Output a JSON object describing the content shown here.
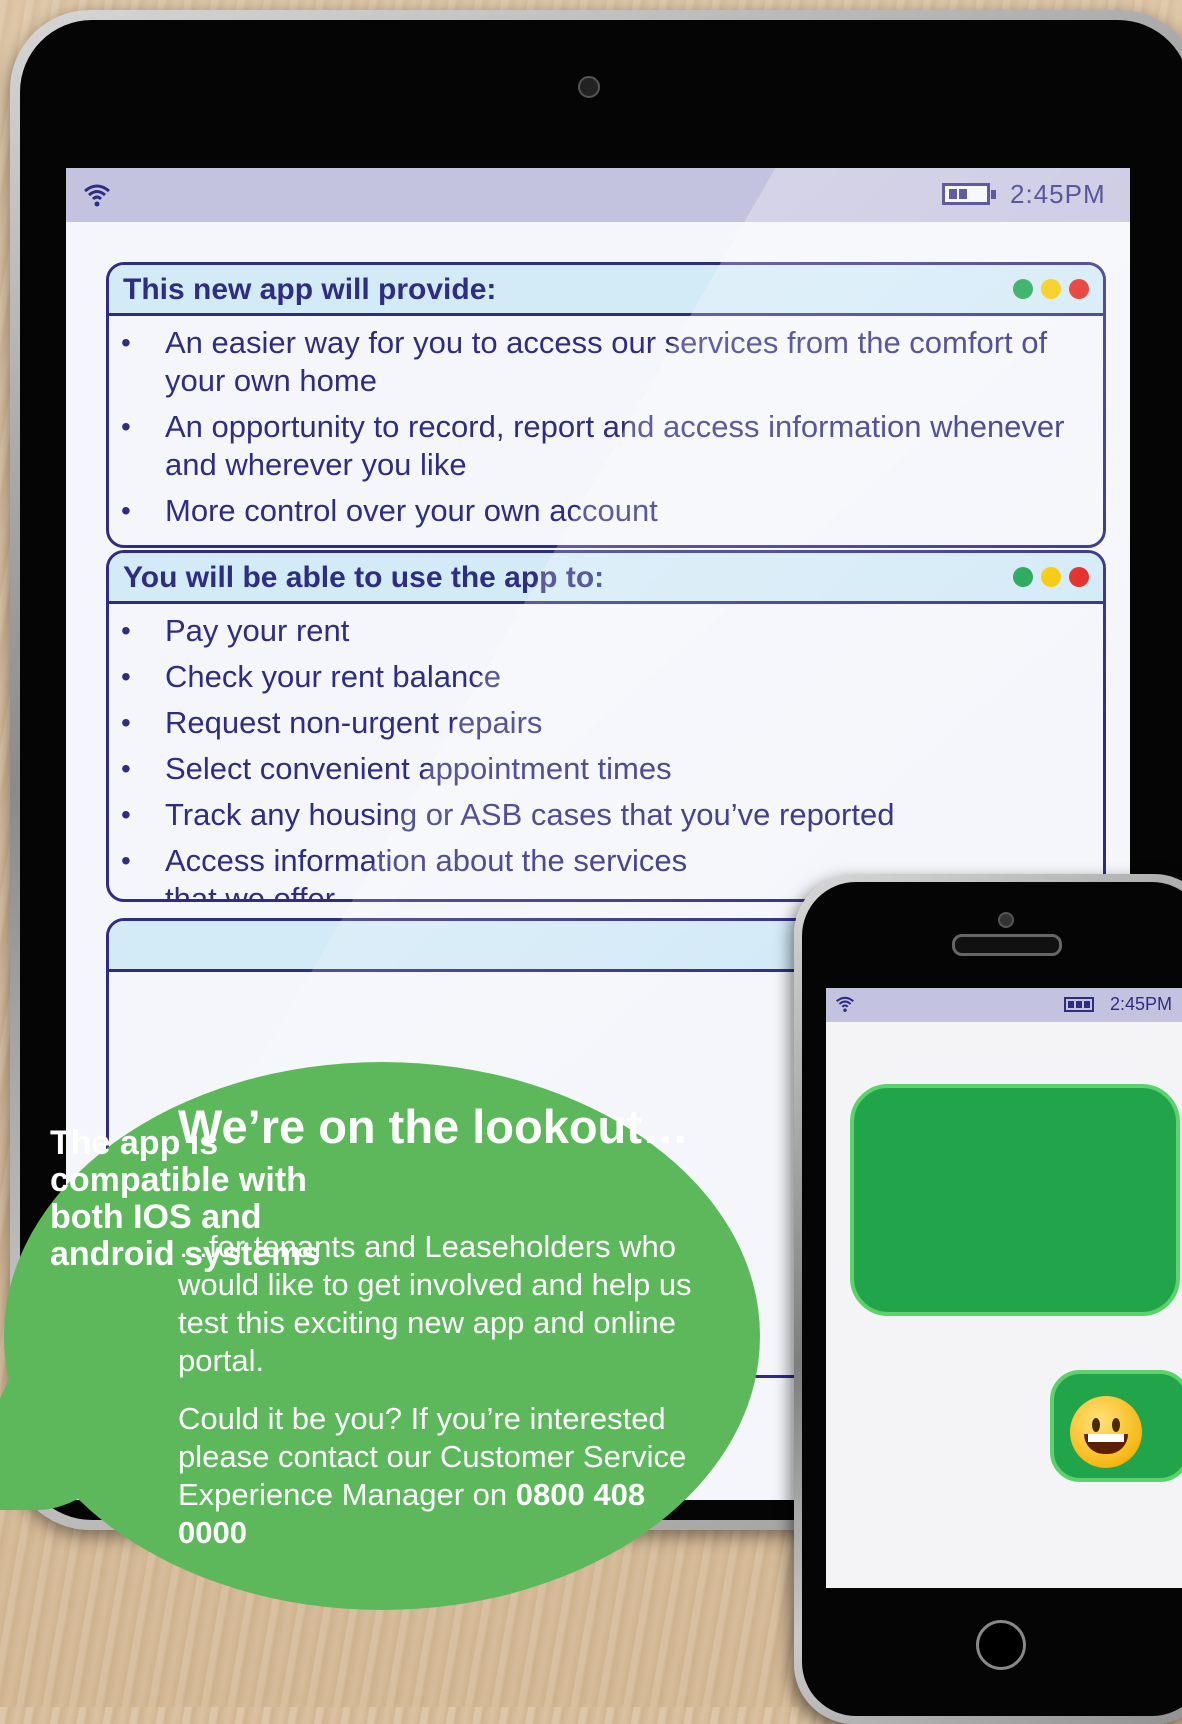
{
  "tablet": {
    "status_time": "2:45PM",
    "card1": {
      "title": "This new app will provide:",
      "items": [
        "An easier way for you to access our services from the comfort of your own home",
        "An opportunity to record, report and access information whenever and wherever you like",
        "More control over your own account"
      ]
    },
    "card2": {
      "title": "You will be able to use the app to:",
      "items": [
        "Pay your rent",
        "Check your rent balance",
        "Request non-urgent repairs",
        "Select convenient appointment times",
        "Track any housing or ASB cases that you’ve reported",
        "Access information about the services that we offer"
      ]
    }
  },
  "bubble": {
    "title": "We’re on the lookout…",
    "body": "…for tenants and Leaseholders who would like to get involved and help us test this exciting new app and online portal.",
    "body2_prefix": "Could it be you? If you’re interested please contact our Customer Service Experience Manager on",
    "phone": "0800 408 0000"
  },
  "phone": {
    "status_time": "2:45PM",
    "message": "The app is compatible with both IOS and android systems",
    "emoji": "smiley"
  },
  "colors": {
    "navy": "#2f2d82",
    "bubble_green": "#5cb85a",
    "message_green": "#22a54a",
    "status_bar": "#c4c3df",
    "card_header": "#d3eaf7"
  }
}
